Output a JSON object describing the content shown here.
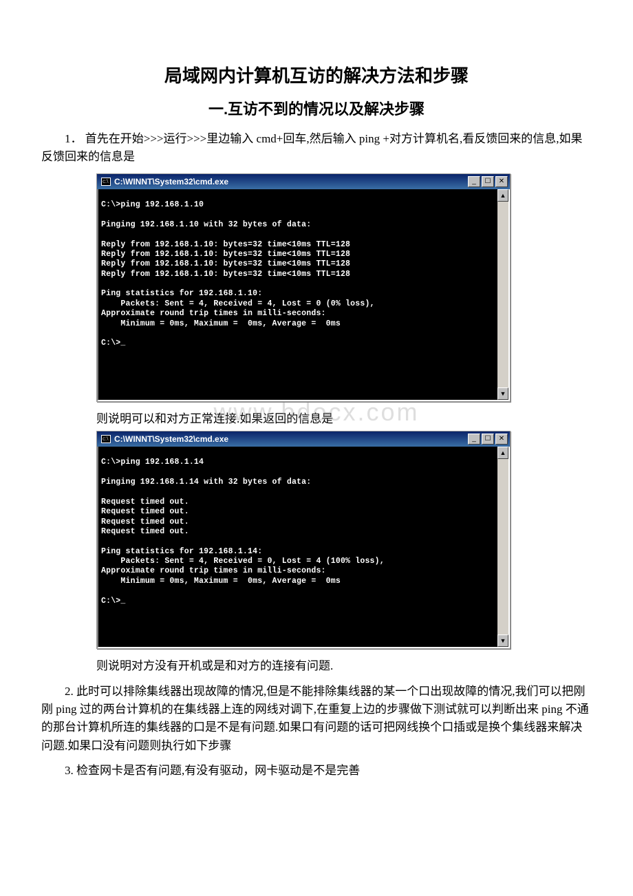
{
  "doc": {
    "title": "局域网内计算机互访的解决方法和步骤",
    "section1_title": "一.互访不到的情况以及解决步骤",
    "para1": "1．  首先在开始>>>运行>>>里边输入 cmd+回车,然后输入 ping +对方计算机名,看反馈回来的信息,如果反馈回来的信息是",
    "connect_ok": "则说明可以和对方正常连接.如果返回的信息是",
    "connect_fail": "则说明对方没有开机或是和对方的连接有问题.",
    "para2": "2. 此时可以排除集线器出现故障的情况,但是不能排除集线器的某一个口出现故障的情况,我们可以把刚刚 ping 过的两台计算机的在集线器上连的网线对调下,在重复上边的步骤做下测试就可以判断出来 ping 不通的那台计算机所连的集线器的口是不是有问题.如果口有问题的话可把网线换个口插或是换个集线器来解决问题.如果口没有问题则执行如下步骤",
    "para3": "3. 检查网卡是否有问题,有没有驱动，网卡驱动是不是完善",
    "watermark": "www.bdocx.com"
  },
  "terminal1": {
    "title": "C:\\WINNT\\System32\\cmd.exe",
    "lines": [
      "",
      "C:\\>ping 192.168.1.10",
      "",
      "Pinging 192.168.1.10 with 32 bytes of data:",
      "",
      "Reply from 192.168.1.10: bytes=32 time<10ms TTL=128",
      "Reply from 192.168.1.10: bytes=32 time<10ms TTL=128",
      "Reply from 192.168.1.10: bytes=32 time<10ms TTL=128",
      "Reply from 192.168.1.10: bytes=32 time<10ms TTL=128",
      "",
      "Ping statistics for 192.168.1.10:",
      "    Packets: Sent = 4, Received = 4, Lost = 0 (0% loss),",
      "Approximate round trip times in milli-seconds:",
      "    Minimum = 0ms, Maximum =  0ms, Average =  0ms",
      "",
      "C:\\>_",
      "",
      "",
      "",
      "",
      "",
      ""
    ]
  },
  "terminal2": {
    "title": "C:\\WINNT\\System32\\cmd.exe",
    "lines": [
      "",
      "C:\\>ping 192.168.1.14",
      "",
      "Pinging 192.168.1.14 with 32 bytes of data:",
      "",
      "Request timed out.",
      "Request timed out.",
      "Request timed out.",
      "Request timed out.",
      "",
      "Ping statistics for 192.168.1.14:",
      "    Packets: Sent = 4, Received = 0, Lost = 4 (100% loss),",
      "Approximate round trip times in milli-seconds:",
      "    Minimum = 0ms, Maximum =  0ms, Average =  0ms",
      "",
      "C:\\>_",
      "",
      "",
      "",
      "",
      ""
    ]
  },
  "win_buttons": {
    "min": "_",
    "max": "☐",
    "close": "✕",
    "up": "▲",
    "down": "▼"
  }
}
